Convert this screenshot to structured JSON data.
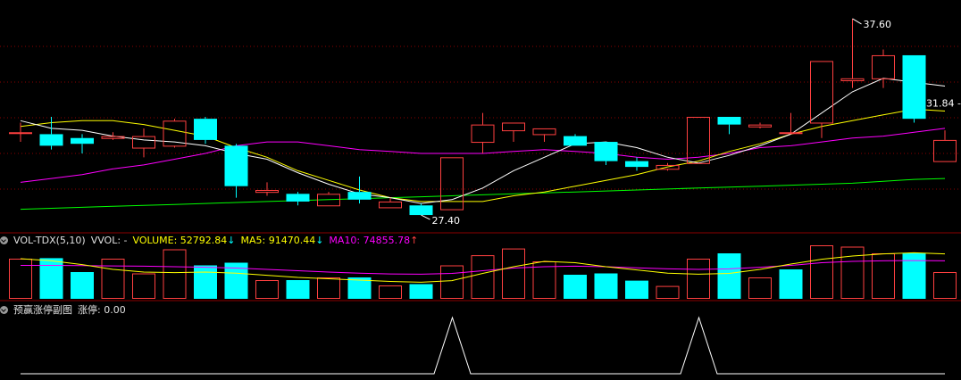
{
  "colors": {
    "up": "#ff4040",
    "down": "#00ffff",
    "ma_white": "#ffffff",
    "ma_yellow": "#ffff00",
    "ma_magenta": "#ff00ff",
    "ma_green": "#00ff00",
    "grid": "#8b0000"
  },
  "price_panel": {
    "max_label": "37.60",
    "min_label": "27.40",
    "last_label": "31.84"
  },
  "volume_panel": {
    "indicator": "VOL-TDX(5,10)",
    "vvol": "VVOL: -",
    "volume_label": "VOLUME: 52792.84",
    "volume_arrow": "↓",
    "ma5_label": "MA5: 91470.44",
    "ma5_arrow": "↓",
    "ma10_label": "MA10: 74855.78",
    "ma10_arrow": "↑"
  },
  "signal_panel": {
    "title": "预赢涨停副图",
    "value_label": "涨停: 0.00",
    "spike_indices": [
      14,
      22
    ]
  },
  "chart_data": {
    "type": "candlestick",
    "ylim": [
      26.8,
      38.2
    ],
    "volume_ylim": [
      0,
      190000
    ],
    "candles": [
      {
        "o": 31.7,
        "c": 31.7,
        "h": 32.2,
        "l": 31.2,
        "up": true
      },
      {
        "o": 31.6,
        "c": 31.0,
        "h": 32.5,
        "l": 30.8,
        "up": false
      },
      {
        "o": 31.4,
        "c": 31.1,
        "h": 31.6,
        "l": 30.6,
        "up": false
      },
      {
        "o": 31.4,
        "c": 31.5,
        "h": 31.7,
        "l": 31.3,
        "up": true
      },
      {
        "o": 30.9,
        "c": 31.5,
        "h": 31.9,
        "l": 30.4,
        "up": true
      },
      {
        "o": 31.0,
        "c": 32.3,
        "h": 32.4,
        "l": 30.9,
        "up": true
      },
      {
        "o": 32.4,
        "c": 31.3,
        "h": 32.5,
        "l": 31.1,
        "up": false
      },
      {
        "o": 31.0,
        "c": 28.9,
        "h": 31.1,
        "l": 28.3,
        "up": false
      },
      {
        "o": 28.6,
        "c": 28.7,
        "h": 29.1,
        "l": 28.4,
        "up": true
      },
      {
        "o": 28.5,
        "c": 28.1,
        "h": 28.6,
        "l": 27.9,
        "up": false
      },
      {
        "o": 27.9,
        "c": 28.5,
        "h": 28.6,
        "l": 27.9,
        "up": true
      },
      {
        "o": 28.6,
        "c": 28.2,
        "h": 29.4,
        "l": 28.0,
        "up": false
      },
      {
        "o": 27.8,
        "c": 28.1,
        "h": 28.3,
        "l": 27.8,
        "up": true
      },
      {
        "o": 27.9,
        "c": 27.4,
        "h": 28.0,
        "l": 27.4,
        "up": false
      },
      {
        "o": 27.7,
        "c": 30.4,
        "h": 30.4,
        "l": 27.7,
        "up": true
      },
      {
        "o": 31.2,
        "c": 32.1,
        "h": 32.7,
        "l": 30.6,
        "up": true
      },
      {
        "o": 31.8,
        "c": 32.2,
        "h": 32.2,
        "l": 31.2,
        "up": true
      },
      {
        "o": 31.6,
        "c": 31.9,
        "h": 31.9,
        "l": 31.2,
        "up": true
      },
      {
        "o": 31.5,
        "c": 31.0,
        "h": 31.6,
        "l": 31.0,
        "up": false
      },
      {
        "o": 31.2,
        "c": 30.2,
        "h": 31.2,
        "l": 30.0,
        "up": false
      },
      {
        "o": 30.2,
        "c": 29.9,
        "h": 30.4,
        "l": 29.7,
        "up": false
      },
      {
        "o": 29.8,
        "c": 30.0,
        "h": 30.1,
        "l": 29.7,
        "up": true
      },
      {
        "o": 30.1,
        "c": 32.5,
        "h": 32.5,
        "l": 30.1,
        "up": true
      },
      {
        "o": 32.5,
        "c": 32.1,
        "h": 32.5,
        "l": 31.6,
        "up": false
      },
      {
        "o": 32.0,
        "c": 32.1,
        "h": 32.2,
        "l": 31.9,
        "up": true
      },
      {
        "o": 31.7,
        "c": 31.7,
        "h": 32.7,
        "l": 31.6,
        "up": true
      },
      {
        "o": 32.2,
        "c": 35.4,
        "h": 35.4,
        "l": 31.4,
        "up": true
      },
      {
        "o": 34.4,
        "c": 34.5,
        "h": 37.6,
        "l": 34.0,
        "up": true
      },
      {
        "o": 34.5,
        "c": 35.7,
        "h": 36.0,
        "l": 34.0,
        "up": true
      },
      {
        "o": 35.7,
        "c": 32.4,
        "h": 35.7,
        "l": 32.2,
        "up": false
      },
      {
        "o": 30.2,
        "c": 31.3,
        "h": 31.8,
        "l": 30.2,
        "up": true
      }
    ],
    "volumes": [
      150000,
      152000,
      100000,
      150000,
      95000,
      185000,
      125000,
      135000,
      70000,
      70000,
      80000,
      80000,
      50000,
      55000,
      125000,
      163000,
      188000,
      140000,
      90000,
      95000,
      68000,
      48000,
      150000,
      170000,
      80000,
      110000,
      200000,
      195000,
      170000,
      170000,
      100000
    ],
    "volume_up": [
      true,
      false,
      false,
      true,
      true,
      true,
      false,
      false,
      true,
      false,
      true,
      false,
      true,
      false,
      true,
      true,
      true,
      true,
      false,
      false,
      false,
      true,
      true,
      false,
      true,
      false,
      true,
      true,
      true,
      false,
      true
    ],
    "ma_white": [
      32.3,
      31.9,
      31.8,
      31.5,
      31.3,
      31.2,
      31.0,
      30.6,
      30.3,
      29.6,
      29.0,
      28.5,
      28.3,
      28.0,
      28.2,
      28.8,
      29.7,
      30.4,
      31.1,
      31.2,
      30.9,
      30.4,
      30.1,
      30.5,
      31.0,
      31.6,
      32.7,
      33.8,
      34.5,
      34.3,
      34.1
    ],
    "ma_yellow": [
      32.0,
      32.2,
      32.3,
      32.3,
      32.1,
      31.8,
      31.5,
      30.9,
      30.4,
      29.7,
      29.2,
      28.7,
      28.3,
      28.1,
      28.1,
      28.1,
      28.4,
      28.6,
      28.9,
      29.2,
      29.5,
      29.9,
      30.2,
      30.7,
      31.1,
      31.6,
      32.0,
      32.3,
      32.6,
      32.9,
      32.8
    ],
    "ma_magenta": [
      29.1,
      29.3,
      29.5,
      29.8,
      30.0,
      30.3,
      30.6,
      31.0,
      31.2,
      31.2,
      31.0,
      30.8,
      30.7,
      30.6,
      30.6,
      30.6,
      30.7,
      30.8,
      30.7,
      30.6,
      30.4,
      30.3,
      30.4,
      30.6,
      30.9,
      31.0,
      31.2,
      31.4,
      31.5,
      31.7,
      31.9
    ],
    "ma_green": [
      27.7,
      27.75,
      27.8,
      27.85,
      27.9,
      27.95,
      28.0,
      28.05,
      28.1,
      28.15,
      28.2,
      28.25,
      28.3,
      28.35,
      28.4,
      28.45,
      28.5,
      28.55,
      28.6,
      28.65,
      28.7,
      28.75,
      28.8,
      28.85,
      28.9,
      28.95,
      29.0,
      29.05,
      29.15,
      29.25,
      29.3
    ],
    "vol_ma_yellow": [
      150000,
      142000,
      128000,
      110000,
      100000,
      98000,
      100000,
      96000,
      88000,
      80000,
      75000,
      70000,
      65000,
      62000,
      68000,
      95000,
      120000,
      140000,
      135000,
      120000,
      108000,
      96000,
      92000,
      95000,
      110000,
      130000,
      148000,
      160000,
      168000,
      172000,
      168000
    ],
    "vol_ma_magenta": [
      125000,
      125000,
      124000,
      123000,
      122000,
      120000,
      118000,
      115000,
      110000,
      105000,
      100000,
      96000,
      93000,
      92000,
      95000,
      105000,
      115000,
      120000,
      122000,
      120000,
      116000,
      112000,
      110000,
      112000,
      118000,
      125000,
      135000,
      140000,
      142000,
      143000,
      142000
    ]
  }
}
